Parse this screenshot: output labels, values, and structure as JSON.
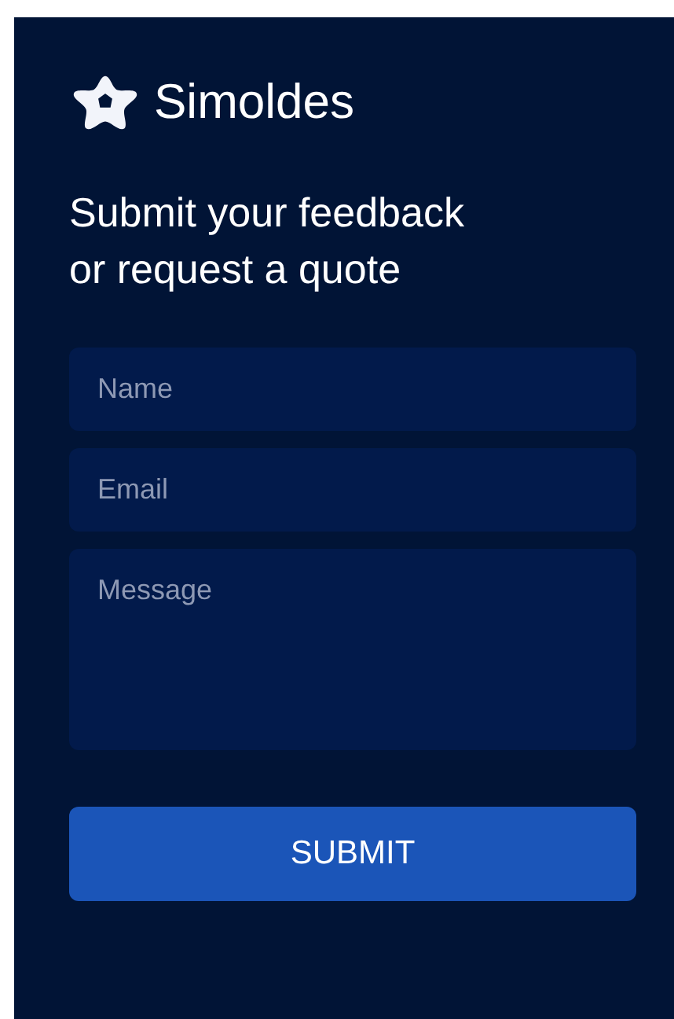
{
  "brand": {
    "name": "Simoldes"
  },
  "heading": "Submit your feedback or request a quote",
  "fields": [
    {
      "kind": "input",
      "placeholder": "Name"
    },
    {
      "kind": "input",
      "placeholder": "Email"
    },
    {
      "kind": "textarea",
      "placeholder": "Message"
    }
  ],
  "submit_button": "SUBMIT"
}
